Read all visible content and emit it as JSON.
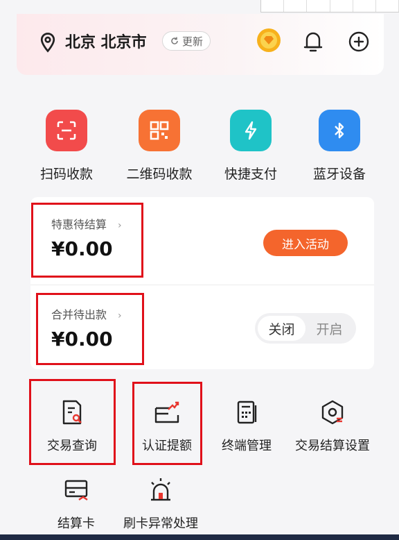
{
  "header": {
    "location": "北京 北京市",
    "refresh_label": "更新"
  },
  "quick_actions": [
    {
      "label": "扫码收款",
      "icon": "scan-icon",
      "color": "#f24b4b"
    },
    {
      "label": "二维码收款",
      "icon": "qrcode-icon",
      "color": "#f77234"
    },
    {
      "label": "快捷支付",
      "icon": "lightning-icon",
      "color": "#1fc3c7"
    },
    {
      "label": "蓝牙设备",
      "icon": "bluetooth-icon",
      "color": "#2f8cf0"
    }
  ],
  "settlement": {
    "discount_label": "特惠待结算",
    "discount_amount": "¥0.00",
    "activity_button": "进入活动",
    "merge_label": "合并待出款",
    "merge_amount": "¥0.00",
    "toggle_off": "关闭",
    "toggle_on": "开启",
    "toggle_selected": "关闭"
  },
  "services": [
    {
      "label": "交易查询",
      "icon": "transaction-query-icon"
    },
    {
      "label": "认证提额",
      "icon": "limit-increase-icon"
    },
    {
      "label": "终端管理",
      "icon": "terminal-icon"
    },
    {
      "label": "交易结算设置",
      "icon": "settlement-settings-icon"
    },
    {
      "label": "结算卡",
      "icon": "settlement-card-icon"
    },
    {
      "label": "刷卡异常处理",
      "icon": "alarm-icon"
    }
  ],
  "colors": {
    "accent": "#f4652c",
    "highlight_border": "#e0101a"
  }
}
